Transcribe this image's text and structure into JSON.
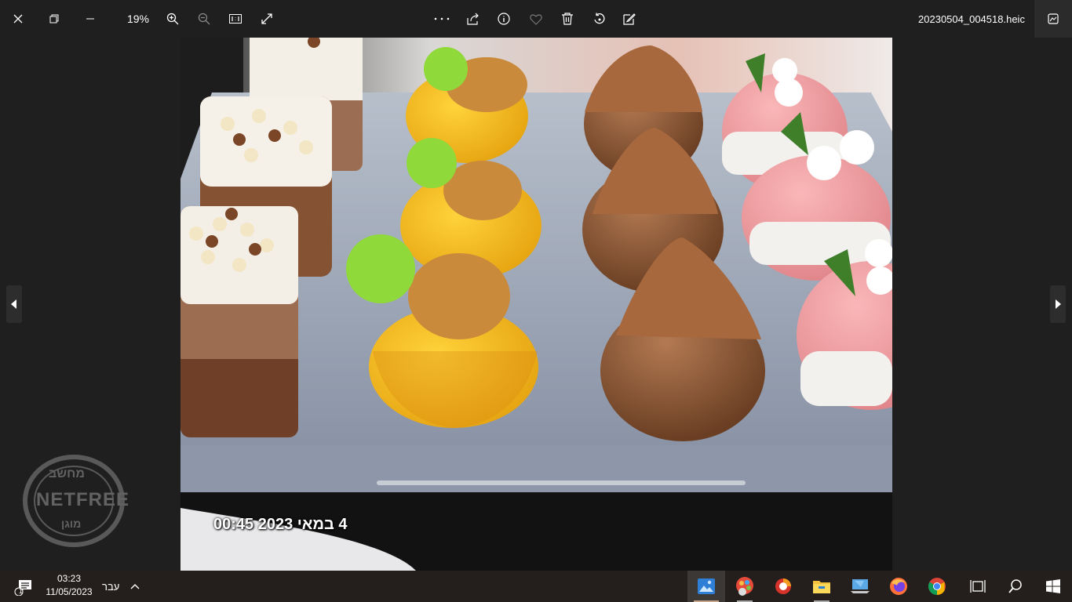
{
  "toolbar": {
    "zoom_level": "19%",
    "filename": "20230504_004518.heic",
    "icons": [
      "close-icon",
      "restore-icon",
      "minimize-icon",
      "zoom-in-icon",
      "zoom-out-icon",
      "actual-size-icon",
      "fullscreen-icon",
      "more-icon",
      "share-icon",
      "info-icon",
      "favorite-icon",
      "delete-icon",
      "rotate-icon",
      "edit-icon",
      "panel-icon"
    ]
  },
  "photo": {
    "date_stamp": "4 במאי 2023 00:45"
  },
  "watermark": {
    "top": "מחשב",
    "middle": "NETFREE",
    "bottom": "מוגן"
  },
  "taskbar": {
    "time": "03:23",
    "date": "11/05/2023",
    "language": "עבר",
    "notification_count": "1",
    "apps": [
      "photos-icon",
      "paint-icon",
      "app-icon",
      "file-explorer-icon",
      "computer-icon",
      "firefox-icon",
      "chrome-icon",
      "task-view-icon",
      "search-icon",
      "start-icon"
    ]
  }
}
